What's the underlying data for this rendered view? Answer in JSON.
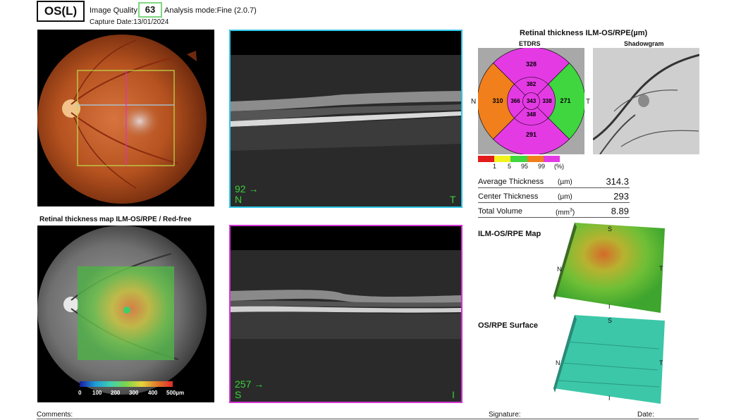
{
  "header": {
    "eye": "OS(L)",
    "image_quality_label": "Image Quality:",
    "image_quality_value": "63",
    "analysis_mode": "Analysis mode:Fine (2.0.7)",
    "capture_date": "Capture Date:13/01/2024"
  },
  "fundus": {
    "map_title": "Retinal thickness map ILM-OS/RPE / Red-free",
    "scale_labels": [
      "0",
      "100",
      "200",
      "300",
      "400",
      "500µm"
    ]
  },
  "oct_top": {
    "number": "92 →",
    "left_letter": "N",
    "right_letter": "T",
    "border_color": "#2fc6e6"
  },
  "oct_bottom": {
    "number": "257 →",
    "left_letter": "S",
    "right_letter": "I",
    "border_color": "#d335d3"
  },
  "thickness": {
    "title": "Retinal thickness ILM-OS/RPE(µm)",
    "etdrs_label": "ETDRS",
    "shadowgram_label": "Shadowgram",
    "side_left": "N",
    "side_right": "T",
    "etdrs": {
      "outer_superior": "328",
      "outer_nasal": "310",
      "outer_temporal": "271",
      "outer_inferior": "291",
      "inner_superior": "382",
      "inner_nasal": "366",
      "inner_temporal": "338",
      "inner_inferior": "348",
      "center": "343"
    },
    "legend": {
      "colors": [
        "#e41b1b",
        "#f2f21e",
        "#3fd63f",
        "#f07f1c",
        "#e43ae4"
      ],
      "ticks": [
        "1",
        "5",
        "95",
        "99",
        "(%)"
      ]
    }
  },
  "stats": {
    "average_label": "Average Thickness",
    "average_unit": "(µm)",
    "average_value": "314.3",
    "center_label": "Center Thickness",
    "center_unit": "(µm)",
    "center_value": "293",
    "volume_label": "Total Volume",
    "volume_unit": "(mm",
    "volume_unit_sup": "3",
    "volume_unit_close": ")",
    "volume_value": "8.89"
  },
  "maps3d": {
    "ilm_title": "ILM-OS/RPE Map",
    "surface_title": "OS/RPE Surface",
    "letters": {
      "s": "S",
      "n": "N",
      "t": "T",
      "i": "I"
    }
  },
  "footer": {
    "comments": "Comments:",
    "signature": "Signature:",
    "date": "Date:"
  }
}
